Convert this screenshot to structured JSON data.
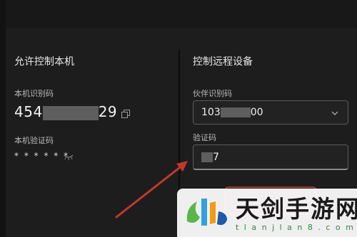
{
  "left_panel": {
    "title": "允许控制本机",
    "id_label": "本机识别码",
    "id_prefix": "454",
    "id_suffix": "29",
    "verify_label": "本机验证码",
    "verify_mask": "* * * * * *"
  },
  "right_panel": {
    "title": "控制远程设备",
    "partner_label": "伙伴识别码",
    "partner_prefix": "103",
    "partner_suffix": "00",
    "verify_label": "验证码",
    "verify_suffix": "7"
  },
  "watermark": {
    "text": "天剑手游网",
    "url": "t l a n j l a n 8 . c o m"
  },
  "icons": {
    "copy": "copy-icon",
    "eye": "eye-hidden-icon",
    "chevron": "chevron-down-icon",
    "arrow": "red-arrow-annotation"
  },
  "colors": {
    "background": "#1d1d1d",
    "annotation_arrow": "#c0392b",
    "watermark_green": "#2f8a3c"
  }
}
